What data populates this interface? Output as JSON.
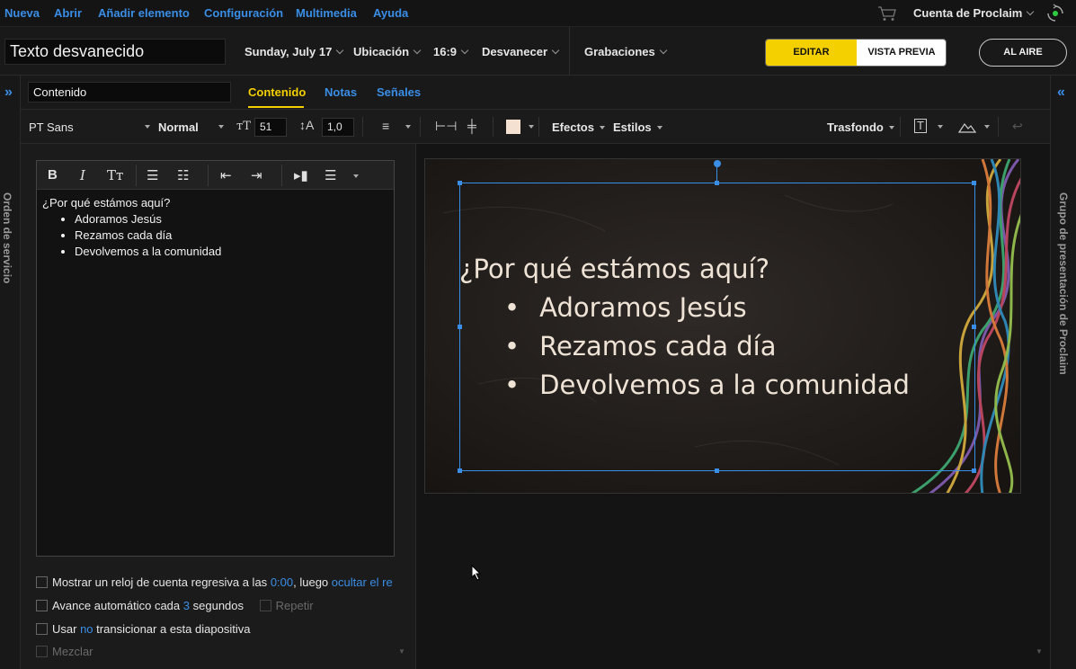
{
  "menu": {
    "items": [
      "Nueva",
      "Abrir",
      "Añadir elemento",
      "Configuración",
      "Multimedia",
      "Ayuda"
    ],
    "account_label": "Cuenta de Proclaim",
    "cart_icon": "cart-icon",
    "sync_icon": "sync-icon"
  },
  "header": {
    "title_value": "Texto desvanecido",
    "date": "Sunday, July 17",
    "location": "Ubicación",
    "aspect": "16:9",
    "transition": "Desvanecer",
    "recordings": "Grabaciones",
    "edit_label": "EDITAR",
    "preview_label": "VISTA PREVIA",
    "live_label": "AL AIRE"
  },
  "rails": {
    "left_label": "Orden de servicio",
    "right_label": "Grupo de presentación de Proclaim",
    "left_arrow": "»",
    "right_arrow": "«"
  },
  "tabs": {
    "name_field": "Contenido",
    "items": [
      "Contenido",
      "Notas",
      "Señales"
    ],
    "active": "Contenido"
  },
  "format": {
    "font": "PT Sans",
    "weight": "Normal",
    "size": "51",
    "line_height": "1,0",
    "effects": "Efectos",
    "styles": "Estilos",
    "background": "Trasfondo",
    "text_color": "#f4e1d2"
  },
  "editor": {
    "heading": "¿Por qué estámos aquí?",
    "bullets": [
      "Adoramos Jesús",
      "Rezamos cada día",
      "Devolvemos a la comunidad"
    ]
  },
  "options": {
    "countdown_pre": "Mostrar un reloj de cuenta regresiva a las",
    "countdown_time": "0:00",
    "countdown_mid": ", luego",
    "countdown_action": "ocultar el re",
    "advance_pre": "Avance automático cada",
    "advance_secs": "3",
    "advance_post": "segundos",
    "repeat": "Repetir",
    "transition_pre": "Usar",
    "transition_no": "no",
    "transition_post": "transicionar a esta diapositiva",
    "mix": "Mezclar"
  },
  "slide": {
    "heading": "¿Por qué estámos aquí?",
    "bullets": [
      "Adoramos Jesús",
      "Rezamos cada día",
      "Devolvemos a la comunidad"
    ]
  },
  "colors": {
    "accent_blue": "#3a8ee6",
    "accent_yellow": "#f5d000",
    "slide_text": "#efe3d6"
  }
}
